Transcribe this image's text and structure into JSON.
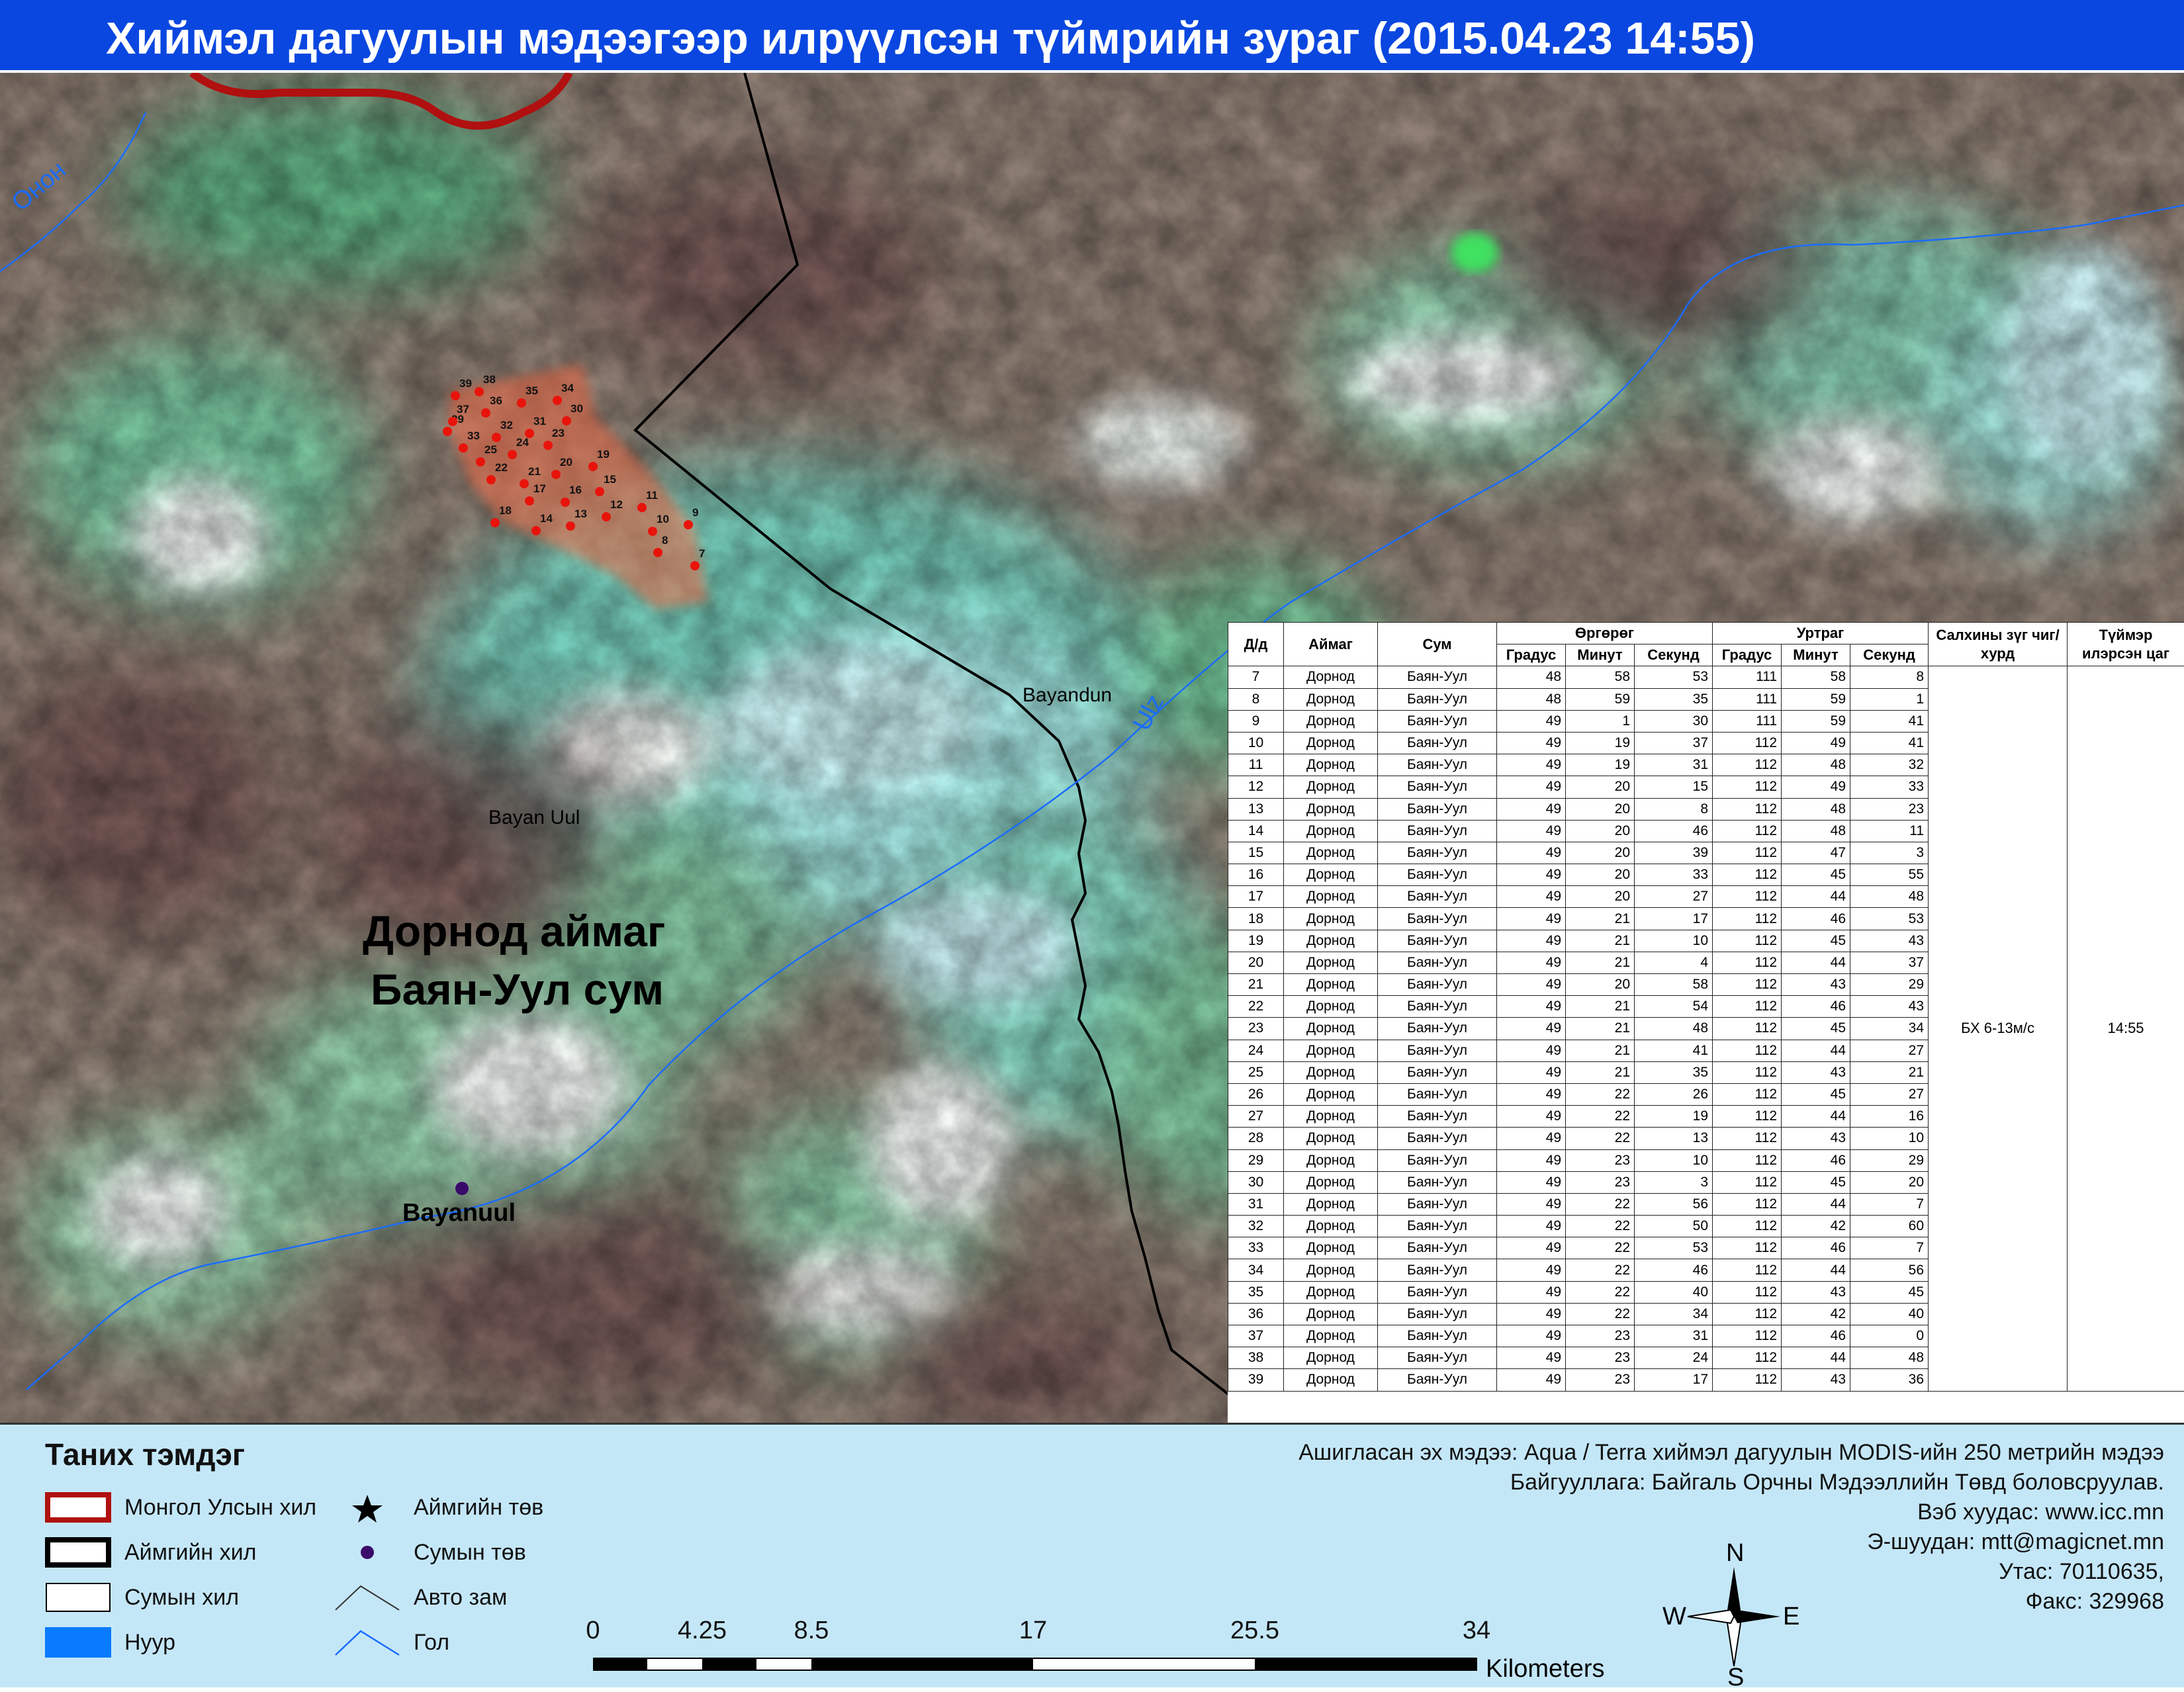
{
  "title": "Хиймэл дагуулын мэдээгээр илрүүлсэн түймрийн зураг  (2015.04.23 14:55)",
  "map": {
    "river_labels": {
      "onon": "Онон",
      "ulz": "Ulz"
    },
    "places": {
      "bayandun": "Bayandun",
      "bayan_uul": "Bayan Uul",
      "bayanuul_center": "Bayanuul"
    },
    "region_label": {
      "line1": "Дорнод аймаг",
      "line2": "Баян-Уул сум"
    },
    "fire_point_ids": [
      "7",
      "8",
      "9",
      "10",
      "11",
      "12",
      "13",
      "14",
      "15",
      "16",
      "17",
      "18",
      "19",
      "20",
      "21",
      "22",
      "23",
      "24",
      "25",
      "29",
      "30",
      "31",
      "32",
      "33",
      "34",
      "35",
      "36",
      "37",
      "38",
      "39"
    ],
    "colors": {
      "fire": "#e8140c",
      "fire_area": "#f06a46",
      "river": "#1a6cff",
      "national_border": "#b01010",
      "aimag_border": "#000000",
      "sum_center": "#3a0a6a"
    }
  },
  "table": {
    "headers": {
      "id": "Д/д",
      "aimag": "Аймаг",
      "sum": "Сум",
      "lat": "Өргөрөг",
      "lon": "Уртраг",
      "deg": "Градус",
      "min": "Минут",
      "sec": "Секунд",
      "wind": "Салхины зүг чиг/хурд",
      "time": "Түймэр илэрсэн цаг"
    },
    "wind_value": "БХ 6-13м/с",
    "time_value": "14:55",
    "rows": [
      [
        "7",
        "Дорнод",
        "Баян-Уул",
        "48",
        "58",
        "53",
        "111",
        "58",
        "8"
      ],
      [
        "8",
        "Дорнод",
        "Баян-Уул",
        "48",
        "59",
        "35",
        "111",
        "59",
        "1"
      ],
      [
        "9",
        "Дорнод",
        "Баян-Уул",
        "49",
        "1",
        "30",
        "111",
        "59",
        "41"
      ],
      [
        "10",
        "Дорнод",
        "Баян-Уул",
        "49",
        "19",
        "37",
        "112",
        "49",
        "41"
      ],
      [
        "11",
        "Дорнод",
        "Баян-Уул",
        "49",
        "19",
        "31",
        "112",
        "48",
        "32"
      ],
      [
        "12",
        "Дорнод",
        "Баян-Уул",
        "49",
        "20",
        "15",
        "112",
        "49",
        "33"
      ],
      [
        "13",
        "Дорнод",
        "Баян-Уул",
        "49",
        "20",
        "8",
        "112",
        "48",
        "23"
      ],
      [
        "14",
        "Дорнод",
        "Баян-Уул",
        "49",
        "20",
        "46",
        "112",
        "48",
        "11"
      ],
      [
        "15",
        "Дорнод",
        "Баян-Уул",
        "49",
        "20",
        "39",
        "112",
        "47",
        "3"
      ],
      [
        "16",
        "Дорнод",
        "Баян-Уул",
        "49",
        "20",
        "33",
        "112",
        "45",
        "55"
      ],
      [
        "17",
        "Дорнод",
        "Баян-Уул",
        "49",
        "20",
        "27",
        "112",
        "44",
        "48"
      ],
      [
        "18",
        "Дорнод",
        "Баян-Уул",
        "49",
        "21",
        "17",
        "112",
        "46",
        "53"
      ],
      [
        "19",
        "Дорнод",
        "Баян-Уул",
        "49",
        "21",
        "10",
        "112",
        "45",
        "43"
      ],
      [
        "20",
        "Дорнод",
        "Баян-Уул",
        "49",
        "21",
        "4",
        "112",
        "44",
        "37"
      ],
      [
        "21",
        "Дорнод",
        "Баян-Уул",
        "49",
        "20",
        "58",
        "112",
        "43",
        "29"
      ],
      [
        "22",
        "Дорнод",
        "Баян-Уул",
        "49",
        "21",
        "54",
        "112",
        "46",
        "43"
      ],
      [
        "23",
        "Дорнод",
        "Баян-Уул",
        "49",
        "21",
        "48",
        "112",
        "45",
        "34"
      ],
      [
        "24",
        "Дорнод",
        "Баян-Уул",
        "49",
        "21",
        "41",
        "112",
        "44",
        "27"
      ],
      [
        "25",
        "Дорнод",
        "Баян-Уул",
        "49",
        "21",
        "35",
        "112",
        "43",
        "21"
      ],
      [
        "26",
        "Дорнод",
        "Баян-Уул",
        "49",
        "22",
        "26",
        "112",
        "45",
        "27"
      ],
      [
        "27",
        "Дорнод",
        "Баян-Уул",
        "49",
        "22",
        "19",
        "112",
        "44",
        "16"
      ],
      [
        "28",
        "Дорнод",
        "Баян-Уул",
        "49",
        "22",
        "13",
        "112",
        "43",
        "10"
      ],
      [
        "29",
        "Дорнод",
        "Баян-Уул",
        "49",
        "23",
        "10",
        "112",
        "46",
        "29"
      ],
      [
        "30",
        "Дорнод",
        "Баян-Уул",
        "49",
        "23",
        "3",
        "112",
        "45",
        "20"
      ],
      [
        "31",
        "Дорнод",
        "Баян-Уул",
        "49",
        "22",
        "56",
        "112",
        "44",
        "7"
      ],
      [
        "32",
        "Дорнод",
        "Баян-Уул",
        "49",
        "22",
        "50",
        "112",
        "42",
        "60"
      ],
      [
        "33",
        "Дорнод",
        "Баян-Уул",
        "49",
        "22",
        "53",
        "112",
        "46",
        "7"
      ],
      [
        "34",
        "Дорнод",
        "Баян-Уул",
        "49",
        "22",
        "46",
        "112",
        "44",
        "56"
      ],
      [
        "35",
        "Дорнод",
        "Баян-Уул",
        "49",
        "22",
        "40",
        "112",
        "43",
        "45"
      ],
      [
        "36",
        "Дорнод",
        "Баян-Уул",
        "49",
        "22",
        "34",
        "112",
        "42",
        "40"
      ],
      [
        "37",
        "Дорнод",
        "Баян-Уул",
        "49",
        "23",
        "31",
        "112",
        "46",
        "0"
      ],
      [
        "38",
        "Дорнод",
        "Баян-Уул",
        "49",
        "23",
        "24",
        "112",
        "44",
        "48"
      ],
      [
        "39",
        "Дорнод",
        "Баян-Уул",
        "49",
        "23",
        "17",
        "112",
        "43",
        "36"
      ]
    ]
  },
  "legend": {
    "title": "Таних тэмдэг",
    "items": [
      {
        "label": "Монгол Улсын хил",
        "icon": "national-border-symbol"
      },
      {
        "label": "Аймгийн хил",
        "icon": "aimag-border-symbol"
      },
      {
        "label": "Сумын хил",
        "icon": "sum-border-symbol"
      },
      {
        "label": "Нуур",
        "icon": "lake-symbol"
      },
      {
        "label": "Аймгийн төв",
        "icon": "star-icon"
      },
      {
        "label": "Сумын төв",
        "icon": "dot-icon"
      },
      {
        "label": "Авто зам",
        "icon": "road-symbol"
      },
      {
        "label": "Гол",
        "icon": "river-symbol"
      }
    ]
  },
  "credits": [
    "Ашигласан эх мэдээ: Aqua / Terra хиймэл дагуулын MODIS-ийн 250 метрийн мэдээ",
    "Байгууллага: Байгаль Орчны Мэдээллийн Төвд боловсруулав.",
    "Вэб хуудас: www.icc.mn",
    "Э-шуудан: mtt@magicnet.mn",
    "Утас: 70110635,",
    "Факс: 329968"
  ],
  "scale_bar": {
    "ticks": [
      "0",
      "4.25",
      "8.5",
      "17",
      "25.5",
      "34"
    ],
    "unit": "Kilometers"
  },
  "compass": {
    "n": "N",
    "s": "S",
    "e": "E",
    "w": "W"
  }
}
